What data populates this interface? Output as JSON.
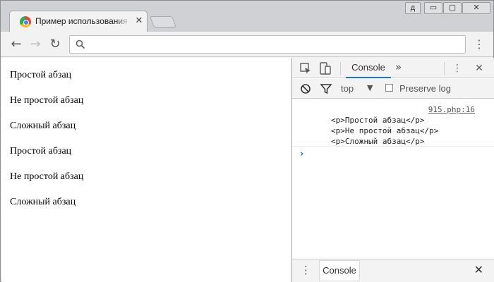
{
  "browser": {
    "tab": {
      "title": "Пример использования ме",
      "close": "✕",
      "icon": "chrome-app-icon"
    },
    "window_controls": {
      "user": "д",
      "minimize": "▭",
      "maximize": "▢",
      "close": "✕"
    },
    "nav": {
      "back": "←",
      "forward": "→",
      "reload": "↻"
    },
    "omnibox": {
      "value": ""
    },
    "menu": "⋮"
  },
  "page": {
    "paragraphs": [
      "Простой абзац",
      "Не простой абзац",
      "Сложный абзац",
      "Простой абзац",
      "Не простой абзац",
      "Сложный абзац"
    ]
  },
  "devtools": {
    "tabs": {
      "console": "Console",
      "more": "»"
    },
    "toolbar": {
      "context": "top",
      "context_arrow": "▼",
      "preserve_log": "Preserve log",
      "preserve_checked": false
    },
    "message": {
      "source": "915.php:16",
      "lines": [
        "<p>Простой абзац</p>",
        "<p>Не простой абзац</p>",
        "<p>Сложный абзац</p>"
      ]
    },
    "prompt": "›",
    "drawer": {
      "tab": "Console",
      "menu": "⋮",
      "close": "✕"
    },
    "close": "✕"
  }
}
